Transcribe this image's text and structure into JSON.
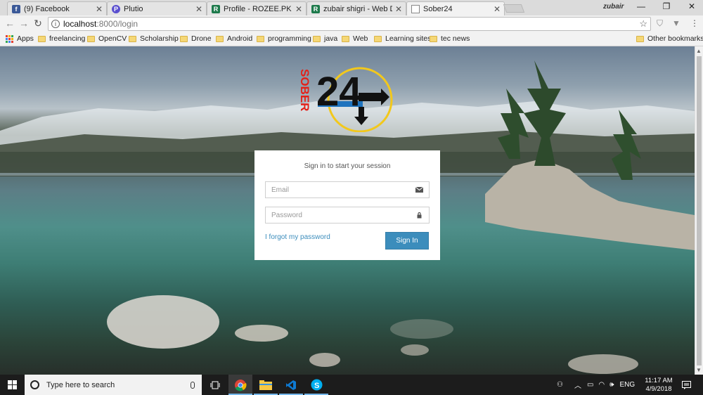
{
  "browser": {
    "tabs": [
      {
        "title": "(9) Facebook",
        "icon": "facebook-icon",
        "color": "#3b5998",
        "glyph": "f",
        "active": false
      },
      {
        "title": "Plutio",
        "icon": "plutio-icon",
        "color": "#5a4fcf",
        "glyph": "P",
        "active": false
      },
      {
        "title": "Profile - ROZEE.PK",
        "icon": "rozee-icon",
        "color": "#1d7a4b",
        "glyph": "R",
        "active": false
      },
      {
        "title": "zubair shigri - Web Deve",
        "icon": "rozee-icon",
        "color": "#1d7a4b",
        "glyph": "R",
        "active": false
      },
      {
        "title": "Sober24",
        "icon": "page-icon",
        "color": "#ffffff",
        "glyph": "",
        "active": true
      }
    ],
    "profile_name": "zubair",
    "address": {
      "host": "localhost",
      "path": ":8000/login"
    },
    "bookmarks": [
      {
        "label": "Apps",
        "type": "apps"
      },
      {
        "label": "freelancing",
        "type": "folder"
      },
      {
        "label": "OpenCV",
        "type": "folder"
      },
      {
        "label": "Scholarship",
        "type": "folder"
      },
      {
        "label": "Drone",
        "type": "folder"
      },
      {
        "label": "Android",
        "type": "folder"
      },
      {
        "label": "programming",
        "type": "folder"
      },
      {
        "label": "java",
        "type": "folder"
      },
      {
        "label": "Web",
        "type": "folder"
      },
      {
        "label": "Learning sites",
        "type": "folder"
      },
      {
        "label": "tec news",
        "type": "folder"
      },
      {
        "label": "Other bookmarks",
        "type": "folder"
      }
    ]
  },
  "page": {
    "logo_text_vertical": "SOBER",
    "logo_number": "24",
    "login": {
      "message": "Sign in to start your session",
      "email_placeholder": "Email",
      "password_placeholder": "Password",
      "forgot_label": "I forgot my password",
      "signin_label": "Sign In"
    }
  },
  "taskbar": {
    "search_placeholder": "Type here to search",
    "language": "ENG",
    "time": "11:17 AM",
    "date": "4/9/2018"
  },
  "colors": {
    "accent": "#3c8dbc",
    "logo_red": "#e32119",
    "logo_yellow": "#f2c81c",
    "logo_blue": "#1e73be"
  }
}
